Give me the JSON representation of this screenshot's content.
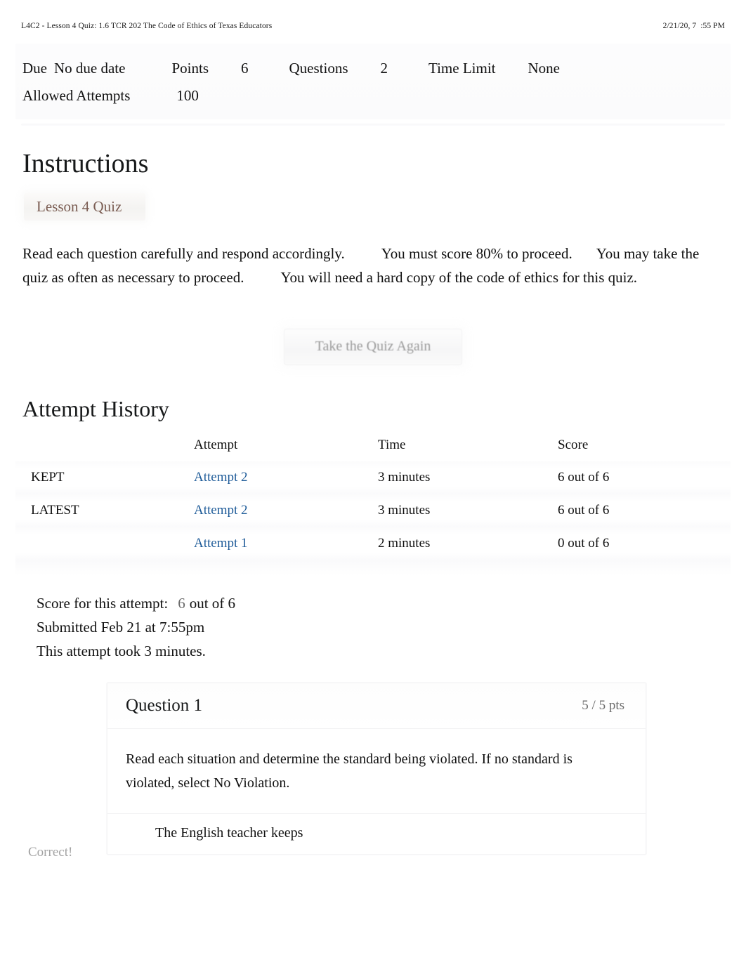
{
  "print_header": {
    "title": "L4C2 - Lesson 4 Quiz: 1.6 TCR 202 The Code of Ethics of Texas Educators",
    "date": "2/21/20, 7  :55 PM"
  },
  "quiz_meta": {
    "due_label": "Due",
    "due_value": "No due date",
    "points_label": "Points",
    "points_value": "6",
    "questions_label": "Questions",
    "questions_value": "2",
    "time_limit_label": "Time Limit",
    "time_limit_value": "None",
    "allowed_attempts_label": "Allowed Attempts",
    "allowed_attempts_value": "100"
  },
  "instructions": {
    "heading": "Instructions",
    "chip": "Lesson 4 Quiz",
    "line1_a": "Read each question carefully and respond accordingly.",
    "line1_b": "You must score 80% to proceed.",
    "line1_c": "You may",
    "line2_a": "take the quiz as often as necessary to proceed.",
    "line2_b": "You will need a hard copy of the code of ethics",
    "line3": "for this quiz."
  },
  "retake_button": {
    "label": "Take the Quiz Again"
  },
  "attempt_history": {
    "heading": "Attempt History",
    "columns": [
      "",
      "Attempt",
      "Time",
      "Score"
    ],
    "rows": [
      {
        "tag": "KEPT",
        "attempt": "Attempt 2",
        "time": "3 minutes",
        "score": "6 out of 6"
      },
      {
        "tag": "LATEST",
        "attempt": "Attempt 2",
        "time": "3 minutes",
        "score": "6 out of 6"
      },
      {
        "tag": "",
        "attempt": "Attempt 1",
        "time": "2 minutes",
        "score": "0 out of 6"
      }
    ]
  },
  "score_summary": {
    "score_label": "Score for this attempt:",
    "score_value": "6",
    "score_out_of": "out of 6",
    "submitted": "Submitted Feb 21 at 7:55pm",
    "duration": "This attempt took 3 minutes."
  },
  "question_1": {
    "title": "Question 1",
    "points": "5 / 5 pts",
    "prompt": "Read each situation and determine the standard being violated. If no standard is violated, select No Violation.",
    "correct_flag": "Correct!",
    "answer_text": "The English teacher keeps"
  },
  "colors": {
    "link": "#1f5c99",
    "chip_text": "#7a5c52",
    "muted": "#6b6b6b",
    "faded": "#a3a3a3"
  }
}
